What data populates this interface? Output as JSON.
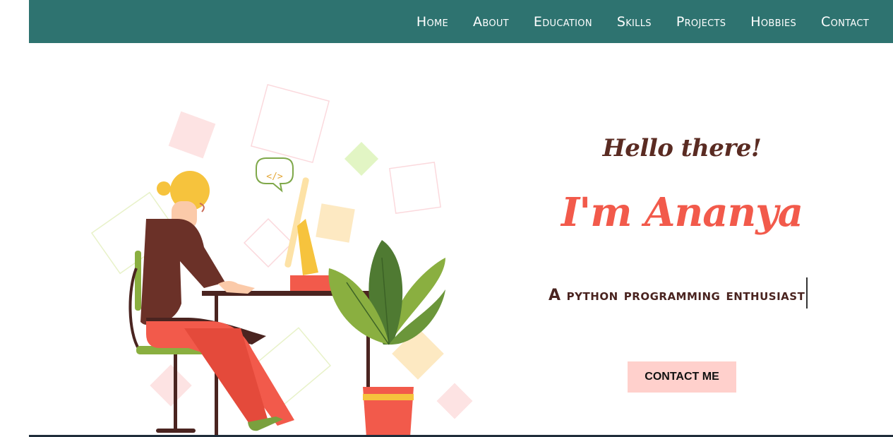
{
  "nav": {
    "items": [
      "Home",
      "About",
      "Education",
      "Skills",
      "Projects",
      "Hobbies",
      "Contact"
    ]
  },
  "hero": {
    "greeting": "Hello there!",
    "name": "I'm Ananya",
    "tagline": "A python programming enthusiast",
    "contact_button": "CONTACT ME"
  },
  "icons": {
    "code_bubble": "</>"
  },
  "colors": {
    "navbar": "#2e7370",
    "greeting": "#5a2b22",
    "name": "#f25a4b",
    "button_bg": "#ffd0cc"
  }
}
